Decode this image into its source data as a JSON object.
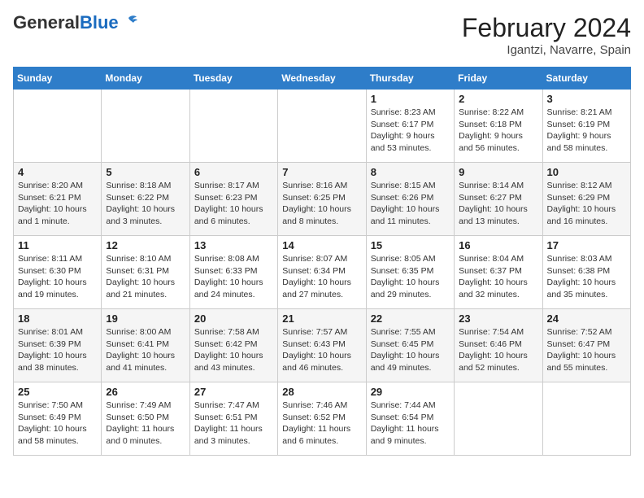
{
  "header": {
    "logo_line1": "General",
    "logo_line2": "Blue",
    "title": "February 2024",
    "subtitle": "Igantzi, Navarre, Spain"
  },
  "weekdays": [
    "Sunday",
    "Monday",
    "Tuesday",
    "Wednesday",
    "Thursday",
    "Friday",
    "Saturday"
  ],
  "weeks": [
    [
      {
        "day": "",
        "info": ""
      },
      {
        "day": "",
        "info": ""
      },
      {
        "day": "",
        "info": ""
      },
      {
        "day": "",
        "info": ""
      },
      {
        "day": "1",
        "info": "Sunrise: 8:23 AM\nSunset: 6:17 PM\nDaylight: 9 hours and 53 minutes."
      },
      {
        "day": "2",
        "info": "Sunrise: 8:22 AM\nSunset: 6:18 PM\nDaylight: 9 hours and 56 minutes."
      },
      {
        "day": "3",
        "info": "Sunrise: 8:21 AM\nSunset: 6:19 PM\nDaylight: 9 hours and 58 minutes."
      }
    ],
    [
      {
        "day": "4",
        "info": "Sunrise: 8:20 AM\nSunset: 6:21 PM\nDaylight: 10 hours and 1 minute."
      },
      {
        "day": "5",
        "info": "Sunrise: 8:18 AM\nSunset: 6:22 PM\nDaylight: 10 hours and 3 minutes."
      },
      {
        "day": "6",
        "info": "Sunrise: 8:17 AM\nSunset: 6:23 PM\nDaylight: 10 hours and 6 minutes."
      },
      {
        "day": "7",
        "info": "Sunrise: 8:16 AM\nSunset: 6:25 PM\nDaylight: 10 hours and 8 minutes."
      },
      {
        "day": "8",
        "info": "Sunrise: 8:15 AM\nSunset: 6:26 PM\nDaylight: 10 hours and 11 minutes."
      },
      {
        "day": "9",
        "info": "Sunrise: 8:14 AM\nSunset: 6:27 PM\nDaylight: 10 hours and 13 minutes."
      },
      {
        "day": "10",
        "info": "Sunrise: 8:12 AM\nSunset: 6:29 PM\nDaylight: 10 hours and 16 minutes."
      }
    ],
    [
      {
        "day": "11",
        "info": "Sunrise: 8:11 AM\nSunset: 6:30 PM\nDaylight: 10 hours and 19 minutes."
      },
      {
        "day": "12",
        "info": "Sunrise: 8:10 AM\nSunset: 6:31 PM\nDaylight: 10 hours and 21 minutes."
      },
      {
        "day": "13",
        "info": "Sunrise: 8:08 AM\nSunset: 6:33 PM\nDaylight: 10 hours and 24 minutes."
      },
      {
        "day": "14",
        "info": "Sunrise: 8:07 AM\nSunset: 6:34 PM\nDaylight: 10 hours and 27 minutes."
      },
      {
        "day": "15",
        "info": "Sunrise: 8:05 AM\nSunset: 6:35 PM\nDaylight: 10 hours and 29 minutes."
      },
      {
        "day": "16",
        "info": "Sunrise: 8:04 AM\nSunset: 6:37 PM\nDaylight: 10 hours and 32 minutes."
      },
      {
        "day": "17",
        "info": "Sunrise: 8:03 AM\nSunset: 6:38 PM\nDaylight: 10 hours and 35 minutes."
      }
    ],
    [
      {
        "day": "18",
        "info": "Sunrise: 8:01 AM\nSunset: 6:39 PM\nDaylight: 10 hours and 38 minutes."
      },
      {
        "day": "19",
        "info": "Sunrise: 8:00 AM\nSunset: 6:41 PM\nDaylight: 10 hours and 41 minutes."
      },
      {
        "day": "20",
        "info": "Sunrise: 7:58 AM\nSunset: 6:42 PM\nDaylight: 10 hours and 43 minutes."
      },
      {
        "day": "21",
        "info": "Sunrise: 7:57 AM\nSunset: 6:43 PM\nDaylight: 10 hours and 46 minutes."
      },
      {
        "day": "22",
        "info": "Sunrise: 7:55 AM\nSunset: 6:45 PM\nDaylight: 10 hours and 49 minutes."
      },
      {
        "day": "23",
        "info": "Sunrise: 7:54 AM\nSunset: 6:46 PM\nDaylight: 10 hours and 52 minutes."
      },
      {
        "day": "24",
        "info": "Sunrise: 7:52 AM\nSunset: 6:47 PM\nDaylight: 10 hours and 55 minutes."
      }
    ],
    [
      {
        "day": "25",
        "info": "Sunrise: 7:50 AM\nSunset: 6:49 PM\nDaylight: 10 hours and 58 minutes."
      },
      {
        "day": "26",
        "info": "Sunrise: 7:49 AM\nSunset: 6:50 PM\nDaylight: 11 hours and 0 minutes."
      },
      {
        "day": "27",
        "info": "Sunrise: 7:47 AM\nSunset: 6:51 PM\nDaylight: 11 hours and 3 minutes."
      },
      {
        "day": "28",
        "info": "Sunrise: 7:46 AM\nSunset: 6:52 PM\nDaylight: 11 hours and 6 minutes."
      },
      {
        "day": "29",
        "info": "Sunrise: 7:44 AM\nSunset: 6:54 PM\nDaylight: 11 hours and 9 minutes."
      },
      {
        "day": "",
        "info": ""
      },
      {
        "day": "",
        "info": ""
      }
    ]
  ]
}
